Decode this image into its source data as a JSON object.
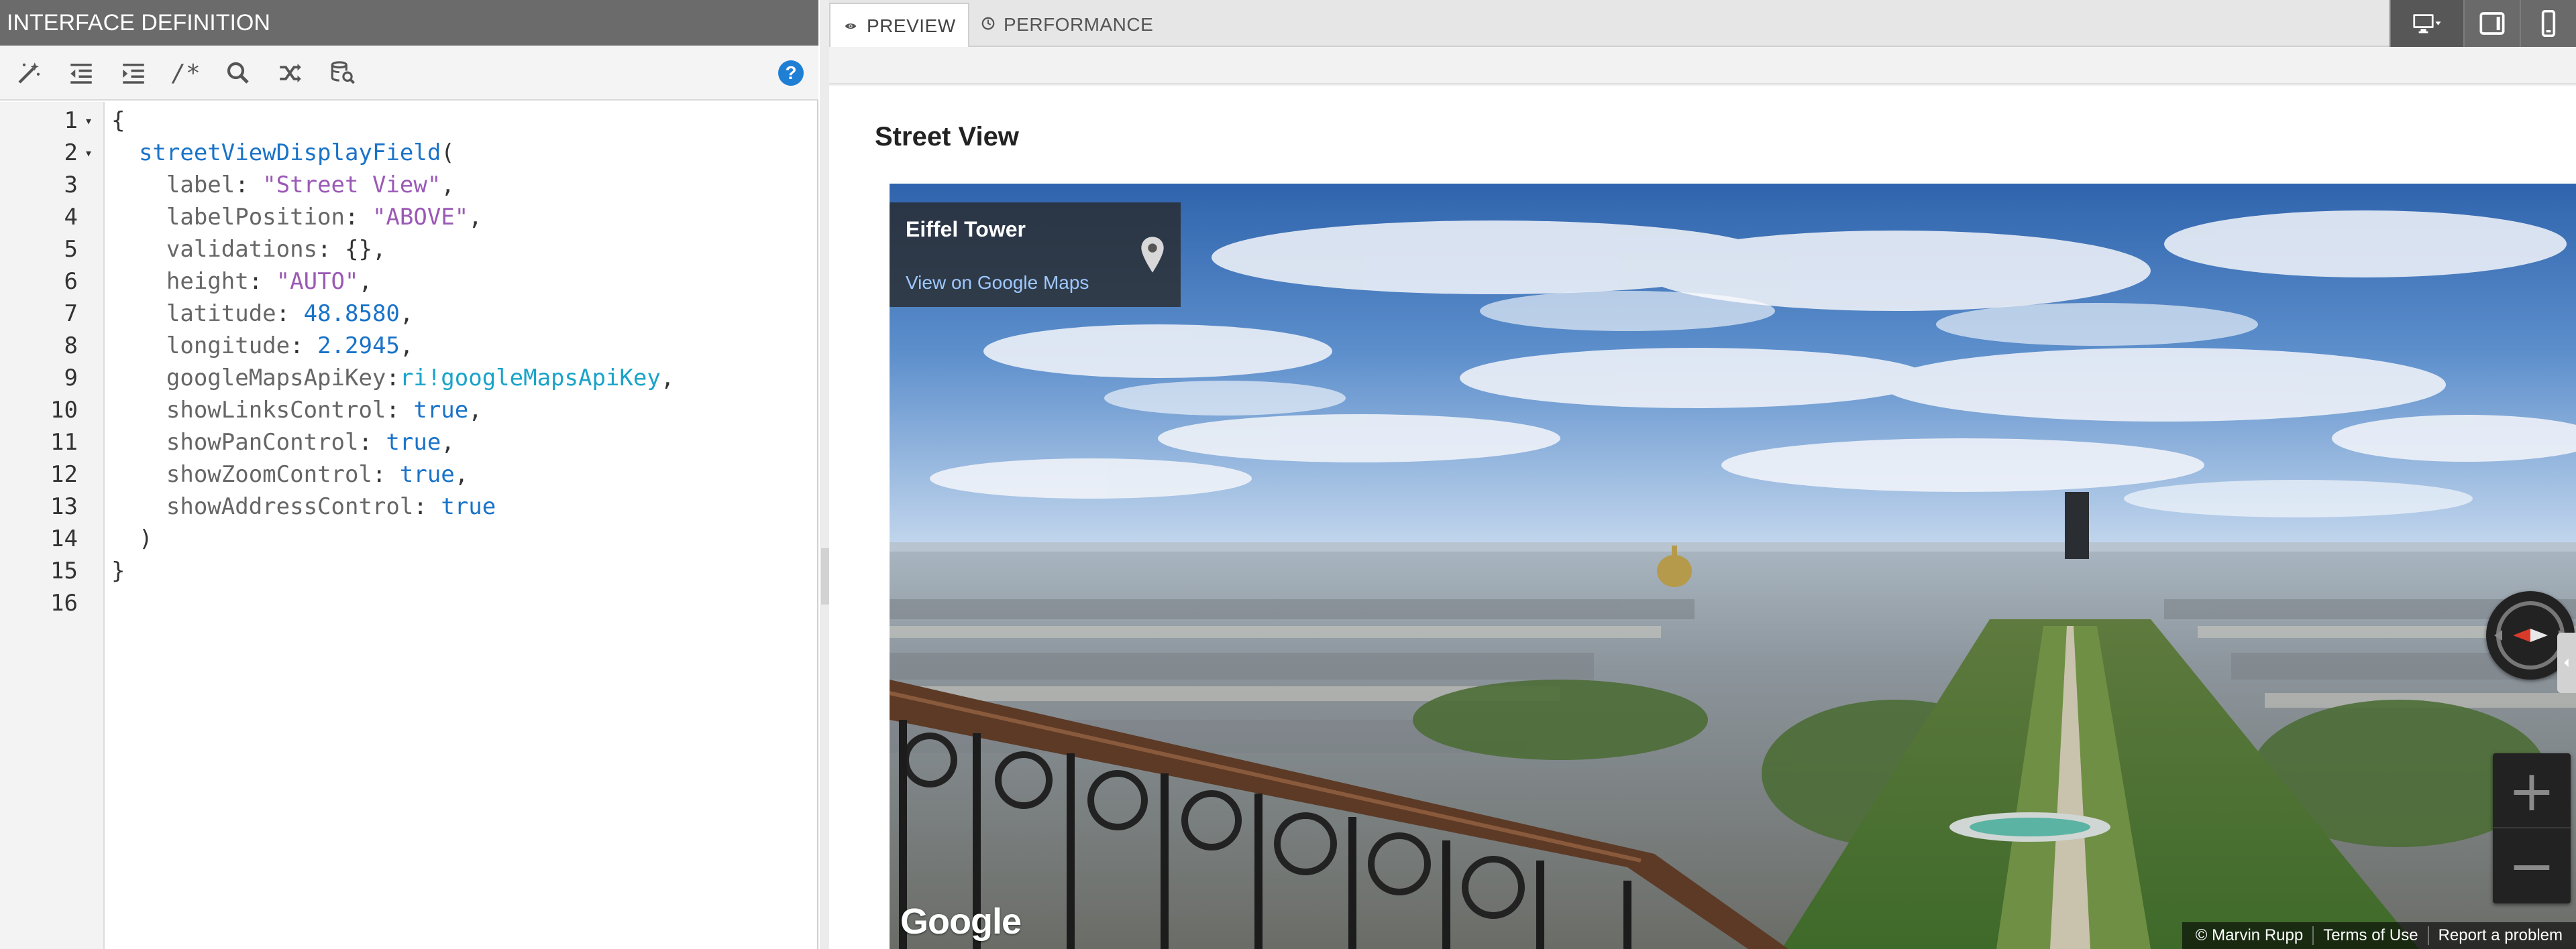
{
  "left_panel": {
    "title": "INTERFACE DEFINITION",
    "toolbar": {
      "buttons": [
        "magic-wand-icon",
        "outdent-icon",
        "indent-icon",
        "comment-icon",
        "search-icon",
        "shuffle-icon",
        "database-search-icon"
      ],
      "comment_label": "/*",
      "help_label": "?"
    },
    "code": [
      {
        "line": "1",
        "fold": "▾",
        "text": "{"
      },
      {
        "line": "2",
        "fold": "▾",
        "text": "  streetViewDisplayField("
      },
      {
        "line": "3",
        "fold": "",
        "text": "    label: \"Street View\","
      },
      {
        "line": "4",
        "fold": "",
        "text": "    labelPosition: \"ABOVE\","
      },
      {
        "line": "5",
        "fold": "",
        "text": "    validations: {},"
      },
      {
        "line": "6",
        "fold": "",
        "text": "    height: \"AUTO\","
      },
      {
        "line": "7",
        "fold": "",
        "text": "    latitude: 48.8580,"
      },
      {
        "line": "8",
        "fold": "",
        "text": "    longitude: 2.2945,"
      },
      {
        "line": "9",
        "fold": "",
        "text": "    googleMapsApiKey:ri!googleMapsApiKey,"
      },
      {
        "line": "10",
        "fold": "",
        "text": "    showLinksControl: true,"
      },
      {
        "line": "11",
        "fold": "",
        "text": "    showPanControl: true,"
      },
      {
        "line": "12",
        "fold": "",
        "text": "    showZoomControl: true,"
      },
      {
        "line": "13",
        "fold": "",
        "text": "    showAddressControl: true"
      },
      {
        "line": "14",
        "fold": "",
        "text": "  )"
      },
      {
        "line": "15",
        "fold": "",
        "text": "}"
      },
      {
        "line": "16",
        "fold": "",
        "text": ""
      }
    ]
  },
  "right_panel": {
    "tabs": [
      {
        "label": "PREVIEW",
        "icon": "eye-icon",
        "active": true
      },
      {
        "label": "PERFORMANCE",
        "icon": "clock-icon",
        "active": false
      }
    ],
    "devices": [
      "desktop-icon",
      "tablet-icon",
      "phone-icon"
    ],
    "field_label": "Street View",
    "streetview": {
      "place_name": "Eiffel Tower",
      "link_text": "View on Google Maps",
      "logo_text": "Google",
      "zoom_in": "+",
      "zoom_out": "−",
      "attribution": [
        "© Marvin Rupp",
        "Terms of Use",
        "Report a problem"
      ]
    }
  },
  "colors": {
    "header_bg": "#6b6b6b",
    "code_function": "#1a73c8",
    "code_string": "#9b59b6",
    "code_variable": "#19a3c9",
    "link": "#9ec8ff",
    "help": "#1e7fd4"
  }
}
